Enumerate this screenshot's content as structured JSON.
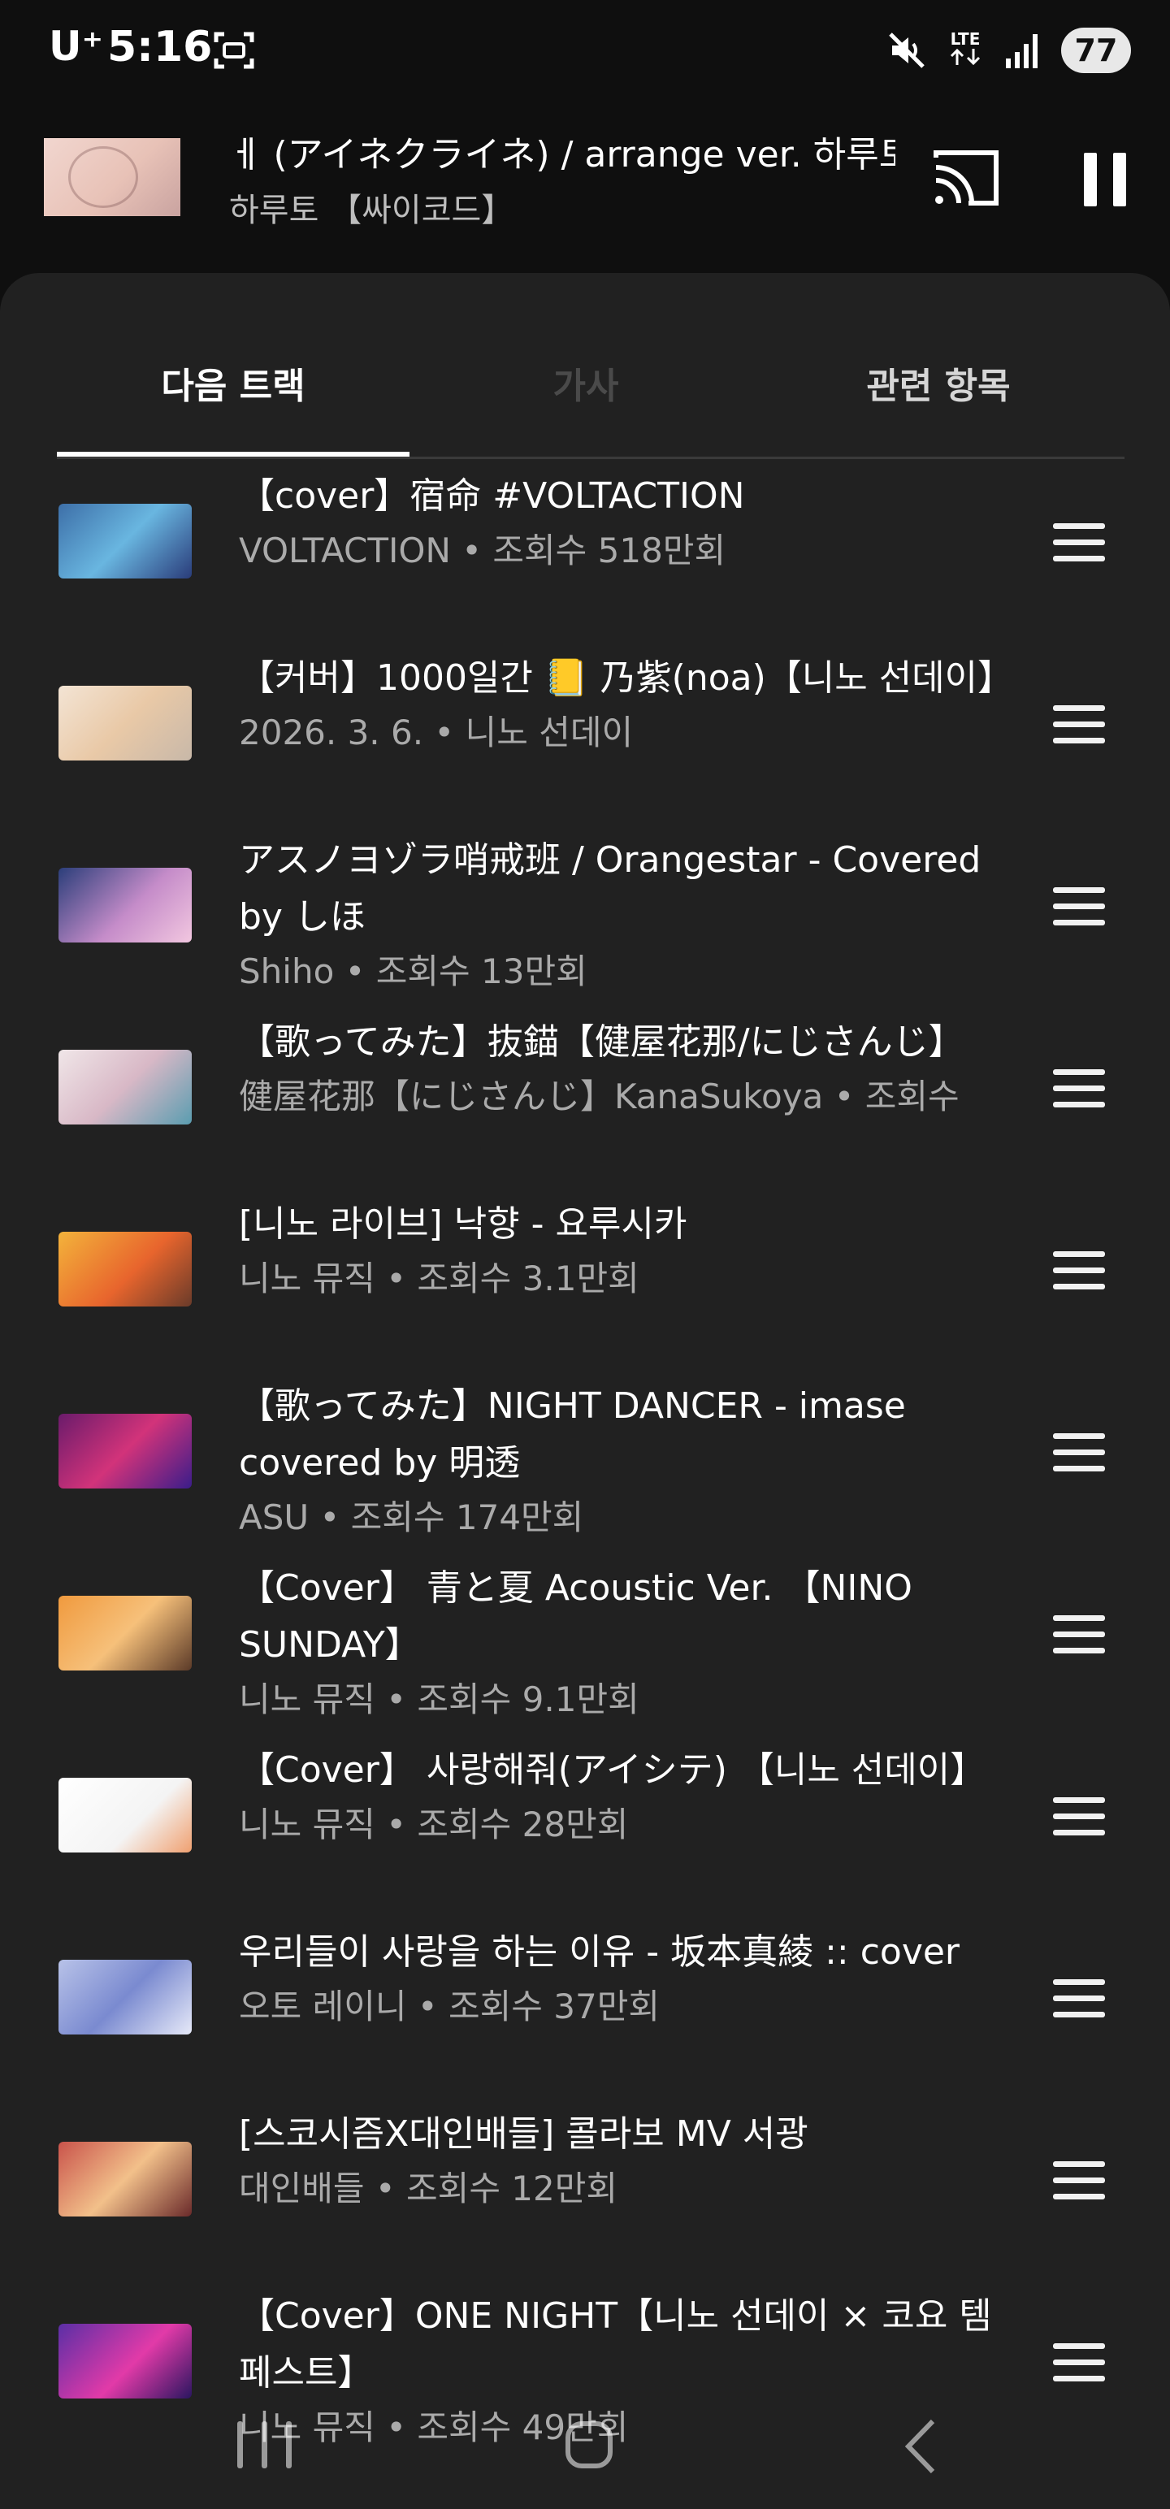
{
  "status_bar": {
    "carrier": "U⁺",
    "time": "5:16",
    "network": "LTE",
    "battery": "77"
  },
  "mini_player": {
    "title": "ㅔ (アイネクライネ) / arrange ver. 하루토",
    "channel": "하루토 【싸이코드】"
  },
  "tabs": [
    {
      "label": "다음 트랙",
      "state": "active"
    },
    {
      "label": "가사",
      "state": "disabled"
    },
    {
      "label": "관련 항목",
      "state": "normal"
    }
  ],
  "queue": [
    {
      "title": "【cover】宿命 #VOLTACTION",
      "subtitle": "VOLTACTION • 조회수 518만회"
    },
    {
      "title": "【커버】1000일간 📒 乃紫(noa)【니노 선데이】",
      "subtitle": "2026. 3. 6. • 니노 선데이"
    },
    {
      "title": "アスノヨゾラ哨戒班 / Orangestar - Covered by しほ",
      "subtitle": "Shiho • 조회수 13만회"
    },
    {
      "title": "【歌ってみた】抜錨【健屋花那/にじさんじ】",
      "subtitle": "健屋花那【にじさんじ】KanaSukoya • 조회수"
    },
    {
      "title": "[니노 라이브] 낙향 - 요루시카",
      "subtitle": "니노 뮤직 • 조회수 3.1만회"
    },
    {
      "title": "【歌ってみた】NIGHT DANCER - imase covered by 明透",
      "subtitle": "ASU • 조회수 174만회"
    },
    {
      "title": "【Cover】 青と夏 Acoustic Ver. 【NINO SUNDAY】",
      "subtitle": "니노 뮤직 • 조회수 9.1만회"
    },
    {
      "title": "【Cover】 사랑해줘(アイシテ) 【니노 선데이】",
      "subtitle": "니노 뮤직 • 조회수 28만회"
    },
    {
      "title": "우리들이 사랑을 하는 이유 - 坂本真綾 :: cover",
      "subtitle": "오토 레이니 • 조회수 37만회"
    },
    {
      "title": "[스코시즘X대인배들] 콜라보 MV 서광",
      "subtitle": "대인배들 • 조회수 12만회"
    },
    {
      "title": "【Cover】ONE NIGHT【니노 선데이 × 코요 템페스트】",
      "subtitle": "니노 뮤직 • 조회수 49만회"
    }
  ],
  "icons": {
    "mini_player": [
      "cast-icon",
      "pause-icon"
    ],
    "row": "drag-handle-icon",
    "nav": [
      "recent-apps-icon",
      "home-icon",
      "back-icon"
    ]
  },
  "colors": {
    "background": "#0f0f0f",
    "sheet": "#212121",
    "secondary_text": "#aaaaaa"
  }
}
